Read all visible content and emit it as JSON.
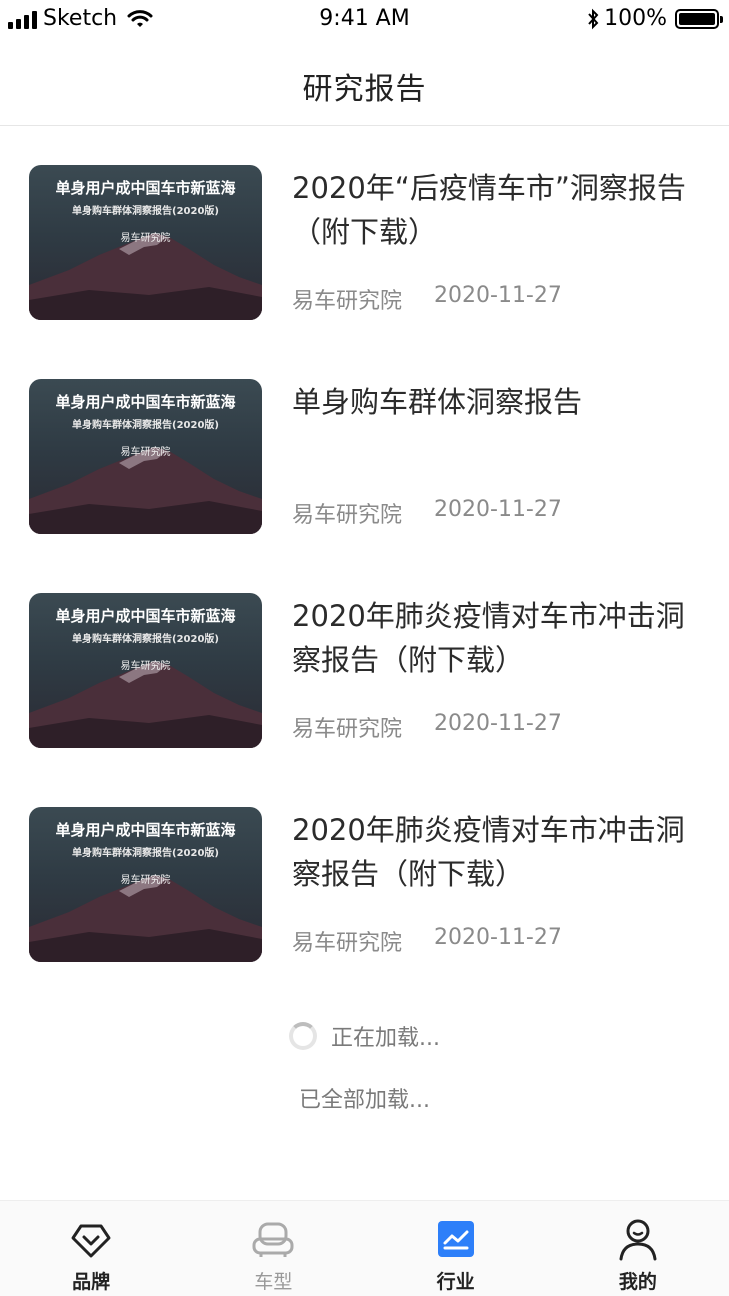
{
  "status_bar": {
    "carrier": "Sketch",
    "time": "9:41 AM",
    "battery": "100%"
  },
  "nav": {
    "title": "研究报告"
  },
  "reports": [
    {
      "thumb_title": "单身用户成中国车市新蓝海",
      "thumb_subtitle": "单身购车群体洞察报告(2020版)",
      "thumb_brand": "易车研究院",
      "title": "2020年“后疫情车市”洞察报告（附下载）",
      "source": "易车研究院",
      "date": "2020-11-27"
    },
    {
      "thumb_title": "单身用户成中国车市新蓝海",
      "thumb_subtitle": "单身购车群体洞察报告(2020版)",
      "thumb_brand": "易车研究院",
      "title": "单身购车群体洞察报告",
      "source": "易车研究院",
      "date": "2020-11-27"
    },
    {
      "thumb_title": "单身用户成中国车市新蓝海",
      "thumb_subtitle": "单身购车群体洞察报告(2020版)",
      "thumb_brand": "易车研究院",
      "title": "2020年肺炎疫情对车市冲击洞察报告（附下载）",
      "source": "易车研究院",
      "date": "2020-11-27"
    },
    {
      "thumb_title": "单身用户成中国车市新蓝海",
      "thumb_subtitle": "单身购车群体洞察报告(2020版)",
      "thumb_brand": "易车研究院",
      "title": "2020年肺炎疫情对车市冲击洞察报告（附下载）",
      "source": "易车研究院",
      "date": "2020-11-27"
    }
  ],
  "loading": {
    "loading_text": "正在加载...",
    "all_loaded_text": "已全部加载..."
  },
  "tabs": [
    {
      "label": "品牌",
      "icon": "brand-diamond-icon",
      "active": false
    },
    {
      "label": "车型",
      "icon": "car-seat-icon",
      "active": false
    },
    {
      "label": "行业",
      "icon": "industry-chart-icon",
      "active": true
    },
    {
      "label": "我的",
      "icon": "profile-icon",
      "active": false
    }
  ],
  "colors": {
    "accent": "#2d7ff9",
    "text_primary": "#2b2b2b",
    "text_secondary": "#8a8a8a"
  }
}
